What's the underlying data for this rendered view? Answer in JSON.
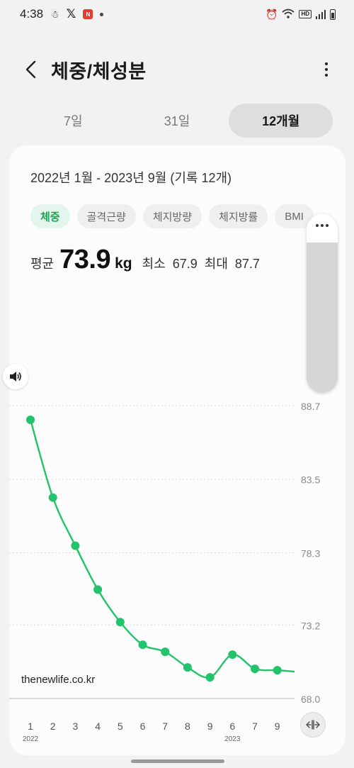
{
  "status_bar": {
    "time": "4:38",
    "icons": [
      "notification-icon",
      "x-icon",
      "app-badge-icon",
      "dot-icon",
      "alarm-icon",
      "wifi-icon",
      "hd-voice-icon",
      "signal-icon",
      "battery-icon"
    ],
    "hd_label": "HD"
  },
  "header": {
    "title": "체중/체성분"
  },
  "range_tabs": [
    {
      "label": "7일",
      "active": false
    },
    {
      "label": "31일",
      "active": false
    },
    {
      "label": "12개월",
      "active": true
    }
  ],
  "card": {
    "date_range": "2022년 1월 - 2023년 9월 (기록 12개)",
    "metric_chips": [
      {
        "label": "체중",
        "active": true
      },
      {
        "label": "골격근량",
        "active": false
      },
      {
        "label": "체지방량",
        "active": false
      },
      {
        "label": "체지방률",
        "active": false
      },
      {
        "label": "BMI",
        "active": false
      }
    ],
    "stats": {
      "avg_label": "평균",
      "avg_value": "73.9",
      "unit": "kg",
      "min_label": "최소",
      "min_value": "67.9",
      "max_label": "최대",
      "max_value": "87.7"
    },
    "watermark": "thenewlife.co.kr"
  },
  "chart_data": {
    "type": "line",
    "x": [
      "1",
      "2",
      "3",
      "4",
      "5",
      "6",
      "7",
      "8",
      "9",
      "6",
      "7",
      "9"
    ],
    "year_labels": [
      {
        "index": 0,
        "label": "2022"
      },
      {
        "index": 9,
        "label": "2023"
      }
    ],
    "series": [
      {
        "values": [
          87.7,
          82.2,
          78.8,
          75.7,
          73.4,
          71.8,
          71.3,
          70.2,
          69.5,
          71.1,
          70.1,
          70.0
        ]
      }
    ],
    "end_value": 69.9,
    "y_ticks": [
      "88.7",
      "83.5",
      "78.3",
      "73.2",
      "68.0"
    ],
    "ylim": [
      68.0,
      88.7
    ],
    "grid": true,
    "color": "#22c36a"
  },
  "colors": {
    "accent_green": "#22c36a",
    "chip_active_text": "#1fa356"
  }
}
